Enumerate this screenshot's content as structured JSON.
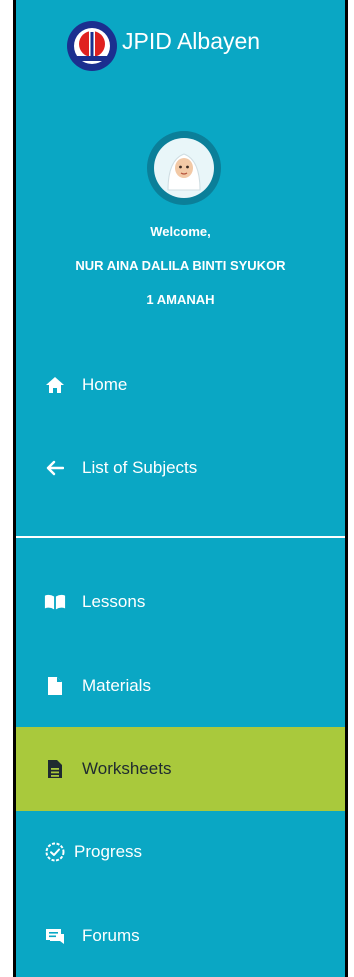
{
  "brand": {
    "name": "JPID Albayen"
  },
  "profile": {
    "welcome": "Welcome,",
    "student_name": "NUR AINA DALILA BINTI SYUKOR",
    "student_class": "1 AMANAH"
  },
  "nav": {
    "home": "Home",
    "list_of_subjects": "List of Subjects"
  },
  "subject_menu": {
    "lessons": "Lessons",
    "materials": "Materials",
    "worksheets": "Worksheets",
    "progress": "Progress",
    "forums": "Forums"
  },
  "colors": {
    "sidebar_bg": "#0aa7c4",
    "active_bg": "#a9c93c",
    "text": "#ffffff"
  },
  "icons": {
    "home": "home-icon",
    "list_of_subjects": "arrow-left-icon",
    "lessons": "book-open-icon",
    "materials": "file-icon",
    "worksheets": "document-lines-icon",
    "progress": "check-circle-icon",
    "forums": "chat-icon"
  }
}
